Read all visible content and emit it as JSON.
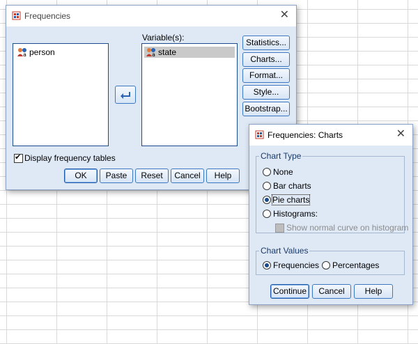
{
  "freq": {
    "title": "Frequencies",
    "source_list": [
      {
        "name": "person"
      }
    ],
    "variables_label": "Variable(s):",
    "variables": [
      {
        "name": "state"
      }
    ],
    "side_buttons": [
      "Statistics...",
      "Charts...",
      "Format...",
      "Style...",
      "Bootstrap..."
    ],
    "display_tables_label": "Display frequency tables",
    "display_tables_checked": true,
    "footer_buttons": [
      "OK",
      "Paste",
      "Reset",
      "Cancel",
      "Help"
    ]
  },
  "charts": {
    "title": "Frequencies: Charts",
    "chart_type_legend": "Chart Type",
    "options": [
      "None",
      "Bar charts",
      "Pie charts",
      "Histograms:"
    ],
    "selected_option": "Pie charts",
    "normal_curve_label": "Show normal curve on histogram",
    "chart_values_legend": "Chart Values",
    "value_options": [
      "Frequencies",
      "Percentages"
    ],
    "selected_value": "Frequencies",
    "buttons": [
      "Continue",
      "Cancel",
      "Help"
    ]
  },
  "colors": {
    "dialog_bg": "#dfe9f6",
    "selection": "#c9c9c9",
    "accent": "#1a4b8c"
  }
}
